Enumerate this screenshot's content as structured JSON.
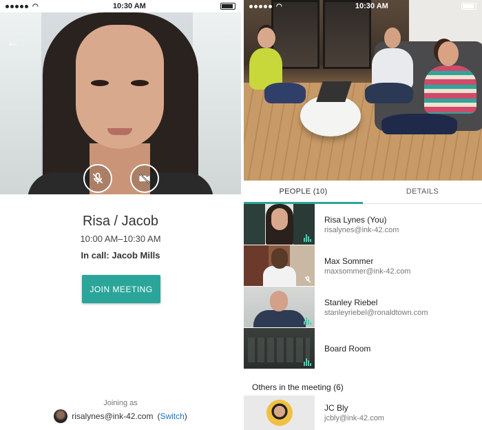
{
  "status": {
    "time": "10:30 AM",
    "time_right": "10:30 AM"
  },
  "left": {
    "meeting_title": "Risa / Jacob",
    "meeting_time": "10:00 AM–10:30 AM",
    "in_call_label": "In call:",
    "in_call_name": "Jacob Mills",
    "join_button": "JOIN MEETING",
    "joining_as_label": "Joining as",
    "account_email": "risalynes@ink-42.com",
    "switch_open": "(",
    "switch_label": "Switch",
    "switch_close": ")"
  },
  "right": {
    "tabs": [
      {
        "label": "PEOPLE (10)",
        "active": true
      },
      {
        "label": "DETAILS",
        "active": false
      }
    ],
    "people": [
      {
        "name": "Risa Lynes (You)",
        "email": "risalynes@ink-42.com",
        "indicator": "audio-level-icon"
      },
      {
        "name": "Max Sommer",
        "email": "maxsommer@ink-42.com",
        "indicator": "mic-muted-icon"
      },
      {
        "name": "Stanley Riebel",
        "email": "stanleyriebel@ronaldtown.com",
        "indicator": "audio-level-icon"
      },
      {
        "name": "Board Room",
        "email": "",
        "indicator": "audio-level-icon"
      }
    ],
    "others_header": "Others in the meeting",
    "others_count": "(6)",
    "others": [
      {
        "name": "JC Bly",
        "email": "jcbly@ink-42.com"
      }
    ]
  },
  "colors": {
    "accent": "#2ba59a",
    "link": "#1a73c8",
    "audio": "#39d6b6"
  }
}
